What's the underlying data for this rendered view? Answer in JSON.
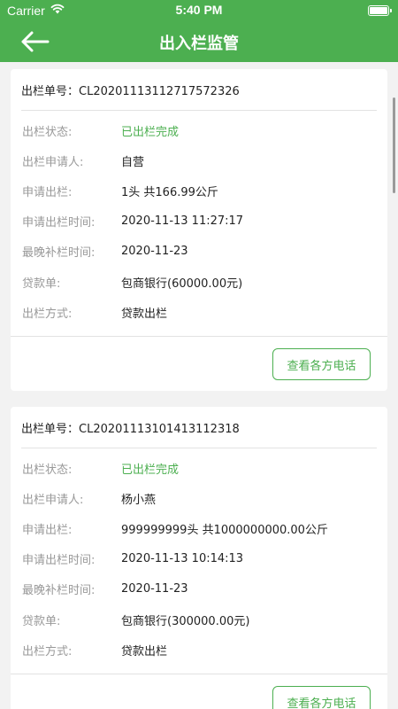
{
  "status_bar": {
    "carrier": "Carrier",
    "time": "5:40 PM"
  },
  "header": {
    "title": "出入栏监管"
  },
  "labels": {
    "order_no": "出栏单号：",
    "status": "出栏状态:",
    "applicant": "出栏申请人:",
    "apply": "申请出栏:",
    "apply_time": "申请出栏时间:",
    "latest_time": "最晚补栏时间:",
    "loan": "贷款单:",
    "method": "出栏方式:"
  },
  "records": [
    {
      "order_no": "CL20201113112717572326",
      "status": "已出栏完成",
      "applicant": "自营",
      "apply": "1头 共166.99公斤",
      "apply_time": "2020-11-13 11:27:17",
      "latest_time": "2020-11-23",
      "loan": "包商银行(60000.00元)",
      "method": "贷款出栏",
      "button": "查看各方电话"
    },
    {
      "order_no": "CL20201113101413112318",
      "status": "已出栏完成",
      "applicant": "杨小燕",
      "apply": "999999999头 共1000000000.00公斤",
      "apply_time": "2020-11-13 10:14:13",
      "latest_time": "2020-11-23",
      "loan": "包商银行(300000.00元)",
      "method": "贷款出栏",
      "button": "查看各方电话"
    }
  ],
  "colors": {
    "accent": "#4caf50",
    "background": "#f2f2f2"
  }
}
